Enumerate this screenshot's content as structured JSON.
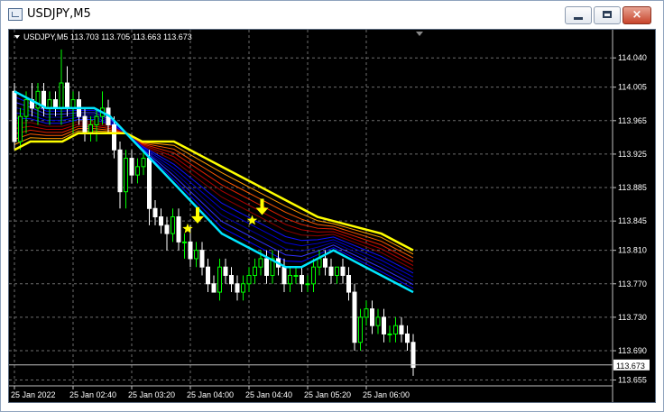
{
  "window": {
    "title": "USDJPY,M5",
    "buttons": {
      "minimize": "minimize",
      "maximize": "maximize",
      "close": "×"
    }
  },
  "chart_header": {
    "text": "USDJPY,M5  113.703 113.705 113.663 113.673"
  },
  "current_price": "113.673",
  "colors": {
    "background": "#000000",
    "bull_candle": "#00ff00",
    "bear_candle": "#ffffff",
    "slow_ma": "#ffff00",
    "fast_ma": "#00e5ff",
    "signal_arrow": "#ffff00"
  },
  "icons": [
    "app-icon",
    "minimize-icon",
    "maximize-icon",
    "close-icon",
    "dropdown-triangle-icon",
    "down-arrow-icon",
    "star-icon"
  ],
  "chart_data": {
    "type": "candlestick",
    "symbol": "USDJPY",
    "timeframe": "M5",
    "grid": true,
    "price_ticks": [
      "114.040",
      "114.005",
      "113.965",
      "113.925",
      "113.885",
      "113.845",
      "113.810",
      "113.770",
      "113.730",
      "113.690",
      "113.655"
    ],
    "time_ticks": [
      "25 Jan 2022",
      "25 Jan 02:40",
      "25 Jan 03:20",
      "25 Jan 04:00",
      "25 Jan 04:40",
      "25 Jan 05:20",
      "25 Jan 06:00"
    ],
    "ylim": [
      113.648,
      114.065
    ],
    "candles": [
      [
        114.0,
        114.01,
        113.93,
        113.94
      ],
      [
        113.94,
        113.98,
        113.93,
        113.97
      ],
      [
        113.97,
        114.0,
        113.95,
        113.99
      ],
      [
        113.99,
        114.01,
        113.97,
        113.98
      ],
      [
        113.98,
        114.01,
        113.96,
        114.0
      ],
      [
        114.0,
        114.01,
        113.97,
        113.98
      ],
      [
        113.98,
        114.0,
        113.96,
        113.99
      ],
      [
        113.99,
        114.0,
        113.97,
        113.98
      ],
      [
        113.98,
        114.05,
        113.96,
        114.01
      ],
      [
        114.01,
        114.03,
        113.97,
        113.98
      ],
      [
        113.98,
        114.0,
        113.95,
        113.99
      ],
      [
        113.99,
        114.0,
        113.96,
        113.97
      ],
      [
        113.97,
        113.98,
        113.94,
        113.95
      ],
      [
        113.95,
        113.97,
        113.94,
        113.96
      ],
      [
        113.96,
        113.98,
        113.94,
        113.97
      ],
      [
        113.97,
        114.0,
        113.96,
        113.98
      ],
      [
        113.98,
        113.99,
        113.95,
        113.96
      ],
      [
        113.96,
        113.97,
        113.92,
        113.93
      ],
      [
        113.93,
        113.94,
        113.86,
        113.88
      ],
      [
        113.88,
        113.93,
        113.86,
        113.92
      ],
      [
        113.92,
        113.93,
        113.89,
        113.9
      ],
      [
        113.9,
        113.92,
        113.89,
        113.91
      ],
      [
        113.91,
        113.93,
        113.9,
        113.92
      ],
      [
        113.92,
        113.93,
        113.84,
        113.86
      ],
      [
        113.86,
        113.87,
        113.84,
        113.85
      ],
      [
        113.85,
        113.86,
        113.83,
        113.84
      ],
      [
        113.84,
        113.85,
        113.81,
        113.83
      ],
      [
        113.83,
        113.86,
        113.82,
        113.85
      ],
      [
        113.85,
        113.86,
        113.81,
        113.82
      ],
      [
        113.82,
        113.83,
        113.8,
        113.82
      ],
      [
        113.82,
        113.84,
        113.79,
        113.8
      ],
      [
        113.8,
        113.82,
        113.79,
        113.81
      ],
      [
        113.81,
        113.82,
        113.78,
        113.79
      ],
      [
        113.79,
        113.8,
        113.76,
        113.77
      ],
      [
        113.77,
        113.78,
        113.76,
        113.76
      ],
      [
        113.76,
        113.8,
        113.75,
        113.79
      ],
      [
        113.79,
        113.8,
        113.77,
        113.78
      ],
      [
        113.78,
        113.79,
        113.76,
        113.77
      ],
      [
        113.77,
        113.78,
        113.75,
        113.76
      ],
      [
        113.76,
        113.78,
        113.75,
        113.77
      ],
      [
        113.77,
        113.79,
        113.76,
        113.78
      ],
      [
        113.78,
        113.8,
        113.77,
        113.79
      ],
      [
        113.79,
        113.81,
        113.78,
        113.8
      ],
      [
        113.8,
        113.81,
        113.77,
        113.78
      ],
      [
        113.78,
        113.81,
        113.77,
        113.8
      ],
      [
        113.8,
        113.81,
        113.78,
        113.79
      ],
      [
        113.79,
        113.8,
        113.76,
        113.77
      ],
      [
        113.77,
        113.79,
        113.76,
        113.78
      ],
      [
        113.78,
        113.79,
        113.77,
        113.78
      ],
      [
        113.78,
        113.79,
        113.76,
        113.77
      ],
      [
        113.77,
        113.78,
        113.76,
        113.77
      ],
      [
        113.77,
        113.8,
        113.76,
        113.79
      ],
      [
        113.79,
        113.81,
        113.78,
        113.8
      ],
      [
        113.8,
        113.81,
        113.78,
        113.79
      ],
      [
        113.79,
        113.8,
        113.77,
        113.78
      ],
      [
        113.78,
        113.79,
        113.77,
        113.79
      ],
      [
        113.79,
        113.8,
        113.77,
        113.78
      ],
      [
        113.78,
        113.79,
        113.75,
        113.76
      ],
      [
        113.76,
        113.77,
        113.69,
        113.7
      ],
      [
        113.7,
        113.74,
        113.69,
        113.73
      ],
      [
        113.73,
        113.75,
        113.72,
        113.74
      ],
      [
        113.74,
        113.75,
        113.71,
        113.72
      ],
      [
        113.72,
        113.74,
        113.71,
        113.73
      ],
      [
        113.73,
        113.74,
        113.7,
        113.71
      ],
      [
        113.71,
        113.72,
        113.7,
        113.71
      ],
      [
        113.71,
        113.73,
        113.7,
        113.72
      ],
      [
        113.72,
        113.73,
        113.7,
        113.71
      ],
      [
        113.71,
        113.72,
        113.69,
        113.7
      ],
      [
        113.7,
        113.71,
        113.66,
        113.67
      ]
    ],
    "moving_averages": [
      {
        "role": "slow",
        "points": [
          113.93,
          113.94,
          113.94,
          113.94,
          113.95,
          113.95,
          113.95,
          113.95,
          113.94,
          113.94,
          113.94,
          113.93,
          113.92,
          113.91,
          113.9,
          113.89,
          113.88,
          113.87,
          113.86,
          113.85,
          113.845,
          113.84,
          113.835,
          113.83,
          113.82,
          113.81
        ]
      },
      {
        "role": "fast",
        "points": [
          114.0,
          113.99,
          113.98,
          113.98,
          113.98,
          113.98,
          113.97,
          113.95,
          113.93,
          113.91,
          113.89,
          113.87,
          113.85,
          113.83,
          113.82,
          113.81,
          113.8,
          113.79,
          113.79,
          113.8,
          113.81,
          113.8,
          113.79,
          113.78,
          113.77,
          113.76
        ]
      }
    ],
    "signals": [
      {
        "index": 30,
        "price": 113.84
      },
      {
        "index": 41,
        "price": 113.85
      }
    ]
  }
}
